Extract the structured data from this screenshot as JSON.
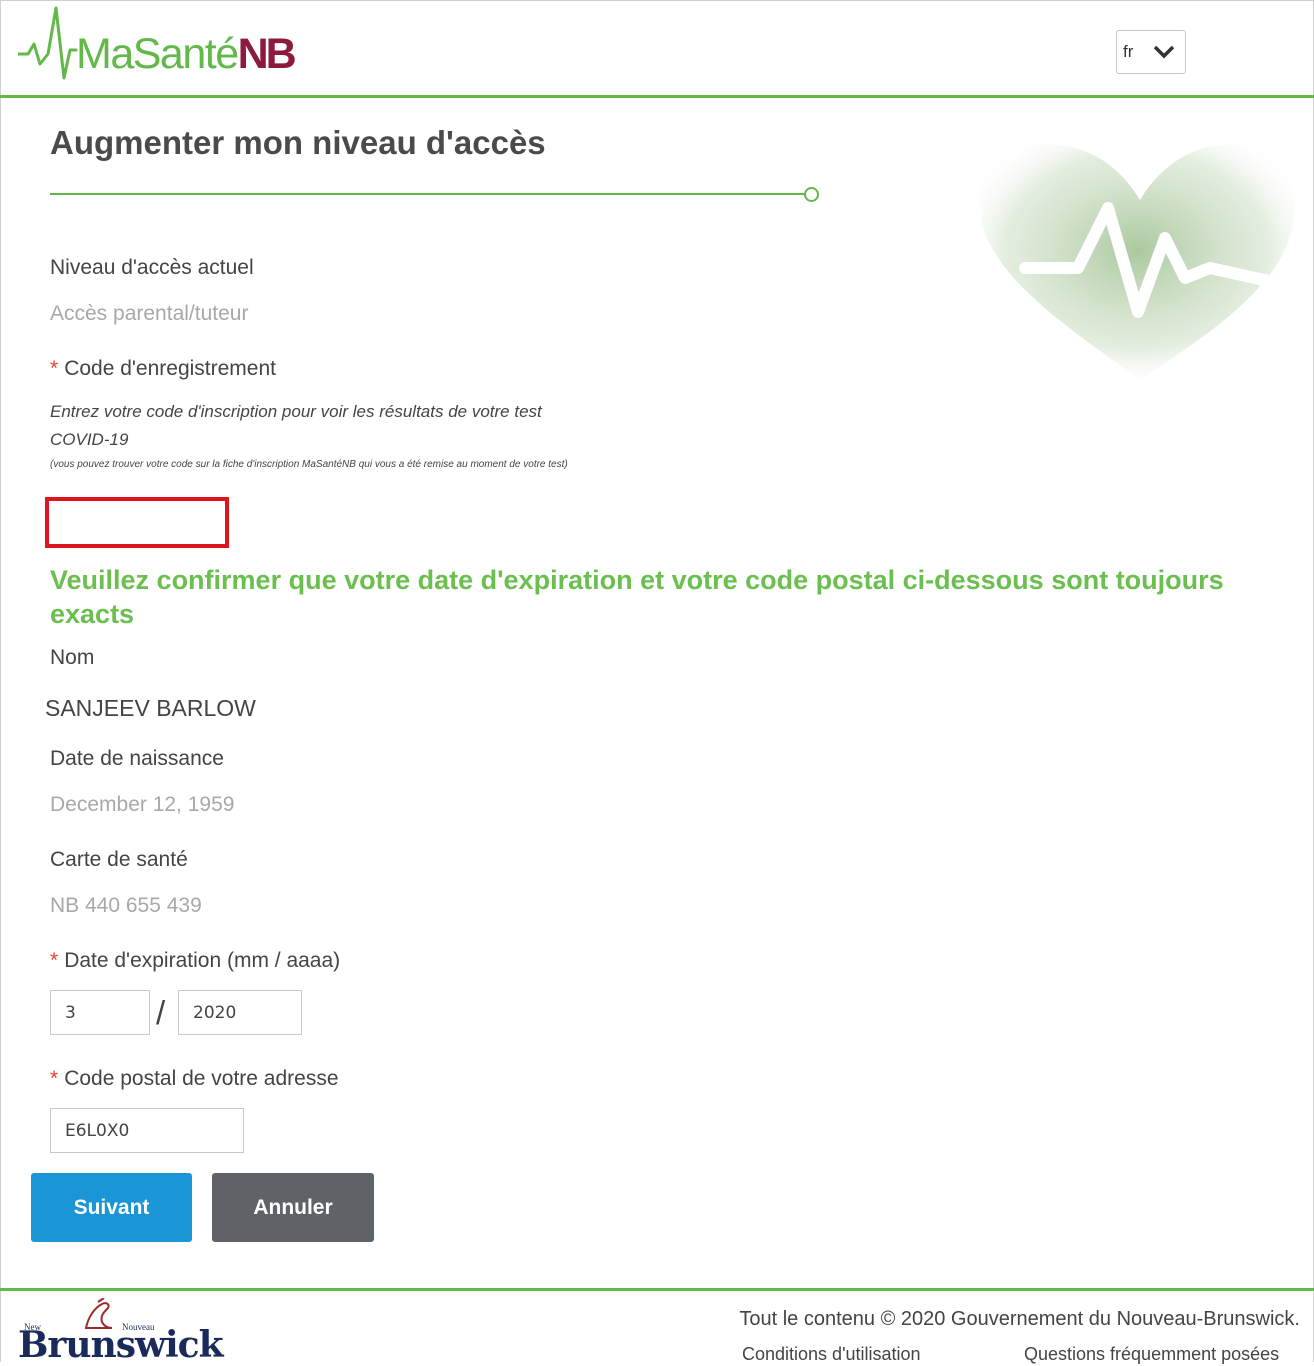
{
  "header": {
    "logo": {
      "ma": "MaSanté",
      "nb": "NB"
    },
    "language_value": "fr"
  },
  "title": "Augmenter mon niveau d'accès",
  "current_access": {
    "label": "Niveau d'accès actuel",
    "value": "Accès parental/tuteur"
  },
  "registration": {
    "required_mark": "*",
    "label": "Code d'enregistrement",
    "hint_line1": "Entrez votre code d'inscription pour voir les résultats de votre test",
    "hint_line2": "COVID-19",
    "hint_small": "(vous pouvez trouver votre code sur la fiche d'inscription MaSantéNB qui vous a été remise au moment de votre test)",
    "value": ""
  },
  "confirm_message": "Veuillez confirmer que votre date d'expiration et votre code postal ci-dessous sont toujours exacts",
  "name": {
    "label": "Nom",
    "value": "SANJEEV BARLOW"
  },
  "dob": {
    "label": "Date de naissance",
    "value": "December 12, 1959"
  },
  "health_card": {
    "label": "Carte de santé",
    "value": "NB 440 655 439"
  },
  "expiry": {
    "label": "Date d'expiration (mm / aaaa)",
    "month": "3",
    "separator": "/",
    "year": "2020"
  },
  "postal": {
    "label": "Code postal de votre adresse",
    "value": "E6L0X0"
  },
  "buttons": {
    "next": "Suivant",
    "cancel": "Annuler"
  },
  "footer": {
    "logo": {
      "new": "New",
      "nouveau": "Nouveau",
      "brunswick": "Brunswick"
    },
    "copyright": "Tout le contenu © 2020 Gouvernement du Nouveau-Brunswick.",
    "terms_link": "Conditions d'utilisation",
    "faq_link": "Questions fréquemment posées"
  },
  "colors": {
    "brand_green": "#63b84a",
    "brand_maroon": "#8b1a3b",
    "primary_button": "#1a96d6",
    "secondary_button": "#5f6367",
    "required": "#e0442a",
    "highlight_border": "#e0141c"
  }
}
